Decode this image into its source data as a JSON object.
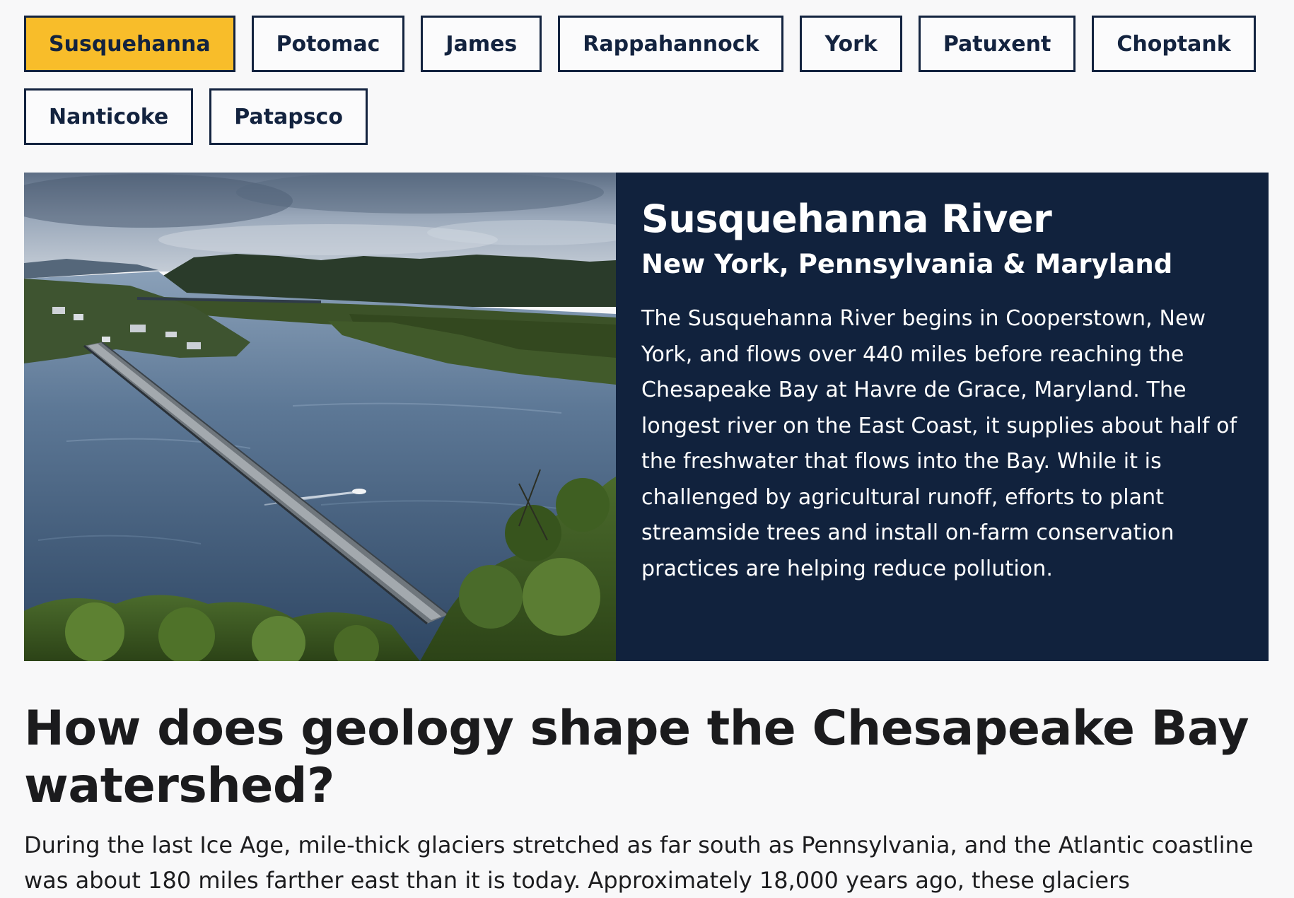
{
  "tabs": [
    {
      "label": "Susquehanna",
      "active": true
    },
    {
      "label": "Potomac",
      "active": false
    },
    {
      "label": "James",
      "active": false
    },
    {
      "label": "Rappahannock",
      "active": false
    },
    {
      "label": "York",
      "active": false
    },
    {
      "label": "Patuxent",
      "active": false
    },
    {
      "label": "Choptank",
      "active": false
    },
    {
      "label": "Nanticoke",
      "active": false
    },
    {
      "label": "Patapsco",
      "active": false
    }
  ],
  "feature": {
    "title": "Susquehanna River",
    "subtitle": "New York, Pennsylvania & Maryland",
    "body": "The Susquehanna River begins in Cooperstown, New York, and flows over 440 miles before reaching the Chesapeake Bay at Havre de Grace, Maryland. The longest river on the East Coast, it supplies about half of the freshwater that flows into the Bay. While it is challenged by agricultural runoff, efforts to plant streamside trees and install on-farm conservation practices are helping reduce pollution."
  },
  "article": {
    "heading": "How does geology shape the Chesapeake Bay watershed?",
    "body": "During the last Ice Age, mile-thick glaciers stretched as far south as Pennsylvania, and the Atlantic coastline was about 180 miles farther east than it is today. Approximately 18,000 years ago, these glaciers"
  },
  "colors": {
    "active_tab": "#f8bd2a",
    "navy": "#11223d",
    "page_background": "#f8f8f9"
  }
}
